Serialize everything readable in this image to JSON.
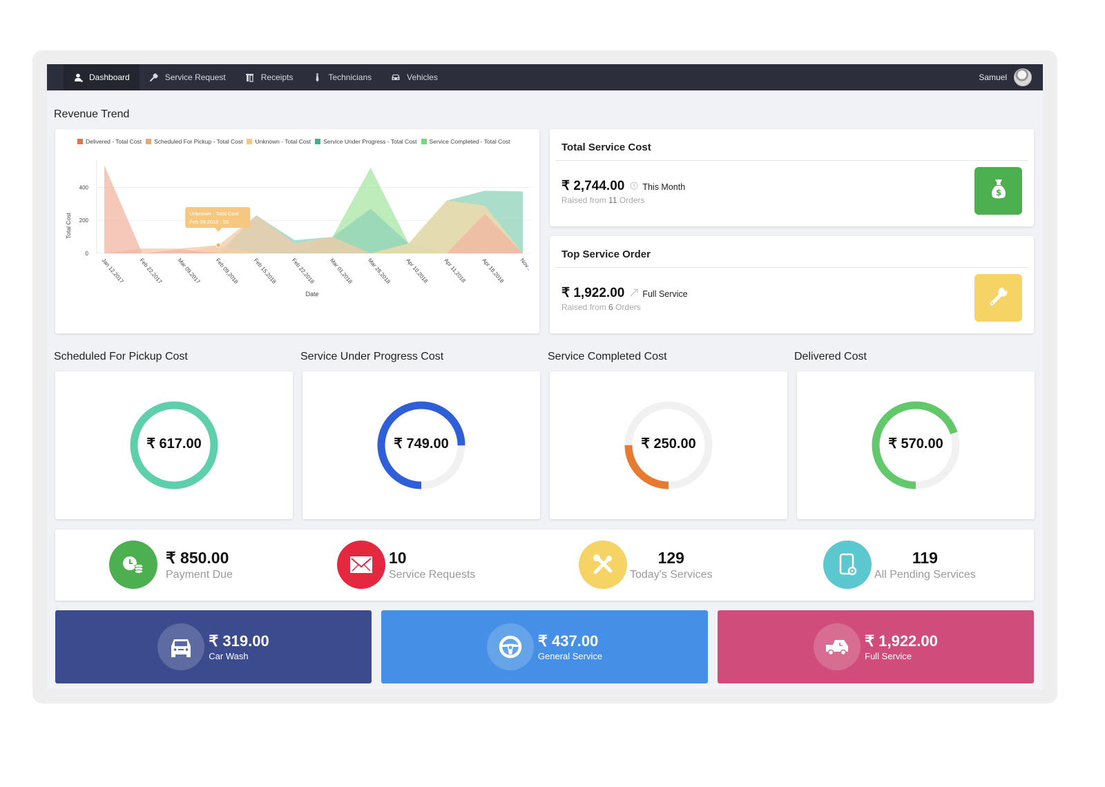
{
  "nav": {
    "items": [
      {
        "label": "Dashboard",
        "icon": "user-icon",
        "active": true
      },
      {
        "label": "Service Request",
        "icon": "wrench-icon",
        "active": false
      },
      {
        "label": "Receipts",
        "icon": "receipt-icon",
        "active": false
      },
      {
        "label": "Technicians",
        "icon": "technician-icon",
        "active": false
      },
      {
        "label": "Vehicles",
        "icon": "car-icon",
        "active": false
      }
    ],
    "user_name": "Samuel"
  },
  "revenue_trend": {
    "title": "Revenue Trend"
  },
  "chart_data": {
    "type": "area",
    "title": "Revenue Trend",
    "xlabel": "Date",
    "ylabel": "Total Cost",
    "ylim": [
      0,
      540
    ],
    "yticks": [
      0,
      200,
      400
    ],
    "grid": true,
    "legend_position": "top",
    "categories": [
      "Jan 12,2017",
      "Feb 22,2017",
      "Mar 09,2017",
      "Feb 09,2018",
      "Feb 15,2018",
      "Feb 22,2018",
      "Mar 01,2018",
      "Mar 28,2018",
      "Apr 10,2018",
      "Apr 11,2018",
      "Apr 18,2018",
      "Nov..."
    ],
    "series": [
      {
        "name": "Service Completed - Total Cost",
        "color": "#a8e6a3",
        "values": [
          0,
          0,
          0,
          0,
          0,
          0,
          100,
          520,
          60,
          0,
          0,
          0
        ]
      },
      {
        "name": "Service Under Progress - Total Cost",
        "color": "#8fd3b8",
        "values": [
          0,
          0,
          0,
          0,
          230,
          80,
          100,
          270,
          60,
          320,
          380,
          375
        ]
      },
      {
        "name": "Unknown - Total Cost",
        "color": "#f8d9a8",
        "values": [
          0,
          0,
          0,
          50,
          0,
          0,
          0,
          0,
          60,
          320,
          290,
          0
        ]
      },
      {
        "name": "Scheduled For Pickup - Total Cost",
        "color": "#f3caa8",
        "values": [
          0,
          30,
          30,
          50,
          230,
          60,
          100,
          0,
          0,
          0,
          0,
          0
        ]
      },
      {
        "name": "Delivered - Total Cost",
        "color": "#f2b5a2",
        "values": [
          535,
          0,
          25,
          0,
          0,
          0,
          0,
          0,
          0,
          0,
          240,
          0
        ]
      }
    ],
    "legend": [
      {
        "name": "Delivered - Total Cost",
        "color": "#e8704f"
      },
      {
        "name": "Scheduled For Pickup - Total Cost",
        "color": "#e8a870"
      },
      {
        "name": "Unknown - Total Cost",
        "color": "#f6c77f"
      },
      {
        "name": "Service Under Progress - Total Cost",
        "color": "#3bb58f"
      },
      {
        "name": "Service Completed - Total Cost",
        "color": "#78d77a"
      }
    ],
    "tooltip": {
      "series": "Unknown - Total Cost",
      "text": "Feb 09,2018 : 50",
      "category": "Feb 09,2018",
      "value": 50
    }
  },
  "total_service_cost": {
    "title": "Total Service Cost",
    "amount": "₹ 2,744.00",
    "period": "This Month",
    "sub_prefix": "Raised from",
    "orders": "11",
    "sub_suffix": "Orders",
    "badge_color": "#4caf50"
  },
  "top_service_order": {
    "title": "Top Service Order",
    "amount": "₹ 1,922.00",
    "service": "Full Service",
    "sub_prefix": "Raised from",
    "orders": "6",
    "sub_suffix": "Orders",
    "badge_color": "#f6d365"
  },
  "donuts": [
    {
      "title": "Scheduled For Pickup Cost",
      "value": "₹ 617.00",
      "fraction": 1.0,
      "color": "#5ecfab"
    },
    {
      "title": "Service Under Progress Cost",
      "value": "₹ 749.00",
      "fraction": 0.75,
      "color": "#2f5fd8"
    },
    {
      "title": "Service Completed Cost",
      "value": "₹ 250.00",
      "fraction": 0.25,
      "color": "#e87a30"
    },
    {
      "title": "Delivered Cost",
      "value": "₹ 570.00",
      "fraction": 0.7,
      "color": "#62c96a"
    }
  ],
  "stats": [
    {
      "value": "₹ 850.00",
      "label": "Payment Due",
      "icon": "payment-clock-icon",
      "color": "#4caf50"
    },
    {
      "value": "10",
      "label": "Service Requests",
      "icon": "mail-icon",
      "color": "#e3283f"
    },
    {
      "value": "129",
      "label": "Today's Services",
      "icon": "tools-icon",
      "color": "#f6d365"
    },
    {
      "value": "119",
      "label": "All Pending Services",
      "icon": "mobile-settings-icon",
      "color": "#5bc8cf"
    }
  ],
  "service_cards": [
    {
      "value": "₹ 319.00",
      "label": "Car Wash",
      "icon": "car-icon",
      "color": "#3b4b8e"
    },
    {
      "value": "₹ 437.00",
      "label": "General Service",
      "icon": "steering-wheel-icon",
      "color": "#4590e6"
    },
    {
      "value": "₹ 1,922.00",
      "label": "Full Service",
      "icon": "van-icon",
      "color": "#d04d7b"
    }
  ]
}
